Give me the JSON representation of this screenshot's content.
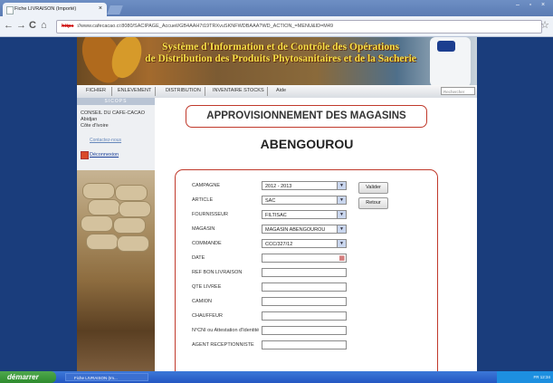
{
  "browser": {
    "tab_title": "Fiche LIVRAISON (Importé)",
    "tab_close": "×",
    "url_https": "https",
    "url_rest": "://www.cafecacao.ci:8080/SACIPAGE_Accueil/GB4AAH7t19TRXvuSKNFWDBAAA?WD_ACTION_=MENU&ID=M49",
    "back": "←",
    "forward": "→",
    "reload": "C",
    "home": "⌂",
    "star": "☆",
    "win_min": "–",
    "win_max": "▫",
    "win_close": "×"
  },
  "banner": {
    "title_line1": "Système d'Information et de Contrôle des Opérations",
    "title_line2": "de Distribution des Produits Phytosanitaires et de la Sacherie"
  },
  "menu": {
    "items": [
      "FICHIER",
      "ENLEVEMENT",
      "DISTRIBUTION",
      "INVENTAIRE STOCKS",
      "Aide"
    ],
    "search_placeholder": "Rechercher"
  },
  "sidebar": {
    "header": "SICOPS",
    "org_line1": "CONSEIL DU CAFE-CACAO",
    "org_line2": "Abidjan",
    "org_line3": "Côte d'Ivoire",
    "contact": "Contactez-nous",
    "logout": "Déconnexion"
  },
  "main": {
    "title": "APPROVISIONNEMENT DES MAGASINS",
    "subtitle": "ABENGOUROU"
  },
  "form": {
    "campagne_label": "CAMPAGNE",
    "campagne_value": "2012 - 2013",
    "article_label": "ARTICLE",
    "article_value": "SAC",
    "fournisseur_label": "FOURNISSEUR",
    "fournisseur_value": "FILTISAC",
    "magasin_label": "MAGASIN",
    "magasin_value": "MAGASIN ABENGOUROU",
    "commande_label": "COMMANDE",
    "commande_value": "CCC/327/12",
    "date_label": "DATE",
    "ref_label": "REF BON LIVRAISON",
    "qte_label": "QTE LIVREE",
    "camion_label": "CAMION",
    "chauffeur_label": "CHAUFFEUR",
    "cni_label": "N°CNI ou Attestation d'Identité",
    "agent_label": "AGENT RECEPTIONNISTE",
    "valider": "Valider",
    "retour": "Retour",
    "arrow": "▼"
  },
  "taskbar": {
    "start": "démarrer",
    "task_item": "Fiche LIVRAISON (Im...",
    "tray": "FR  12:34"
  }
}
